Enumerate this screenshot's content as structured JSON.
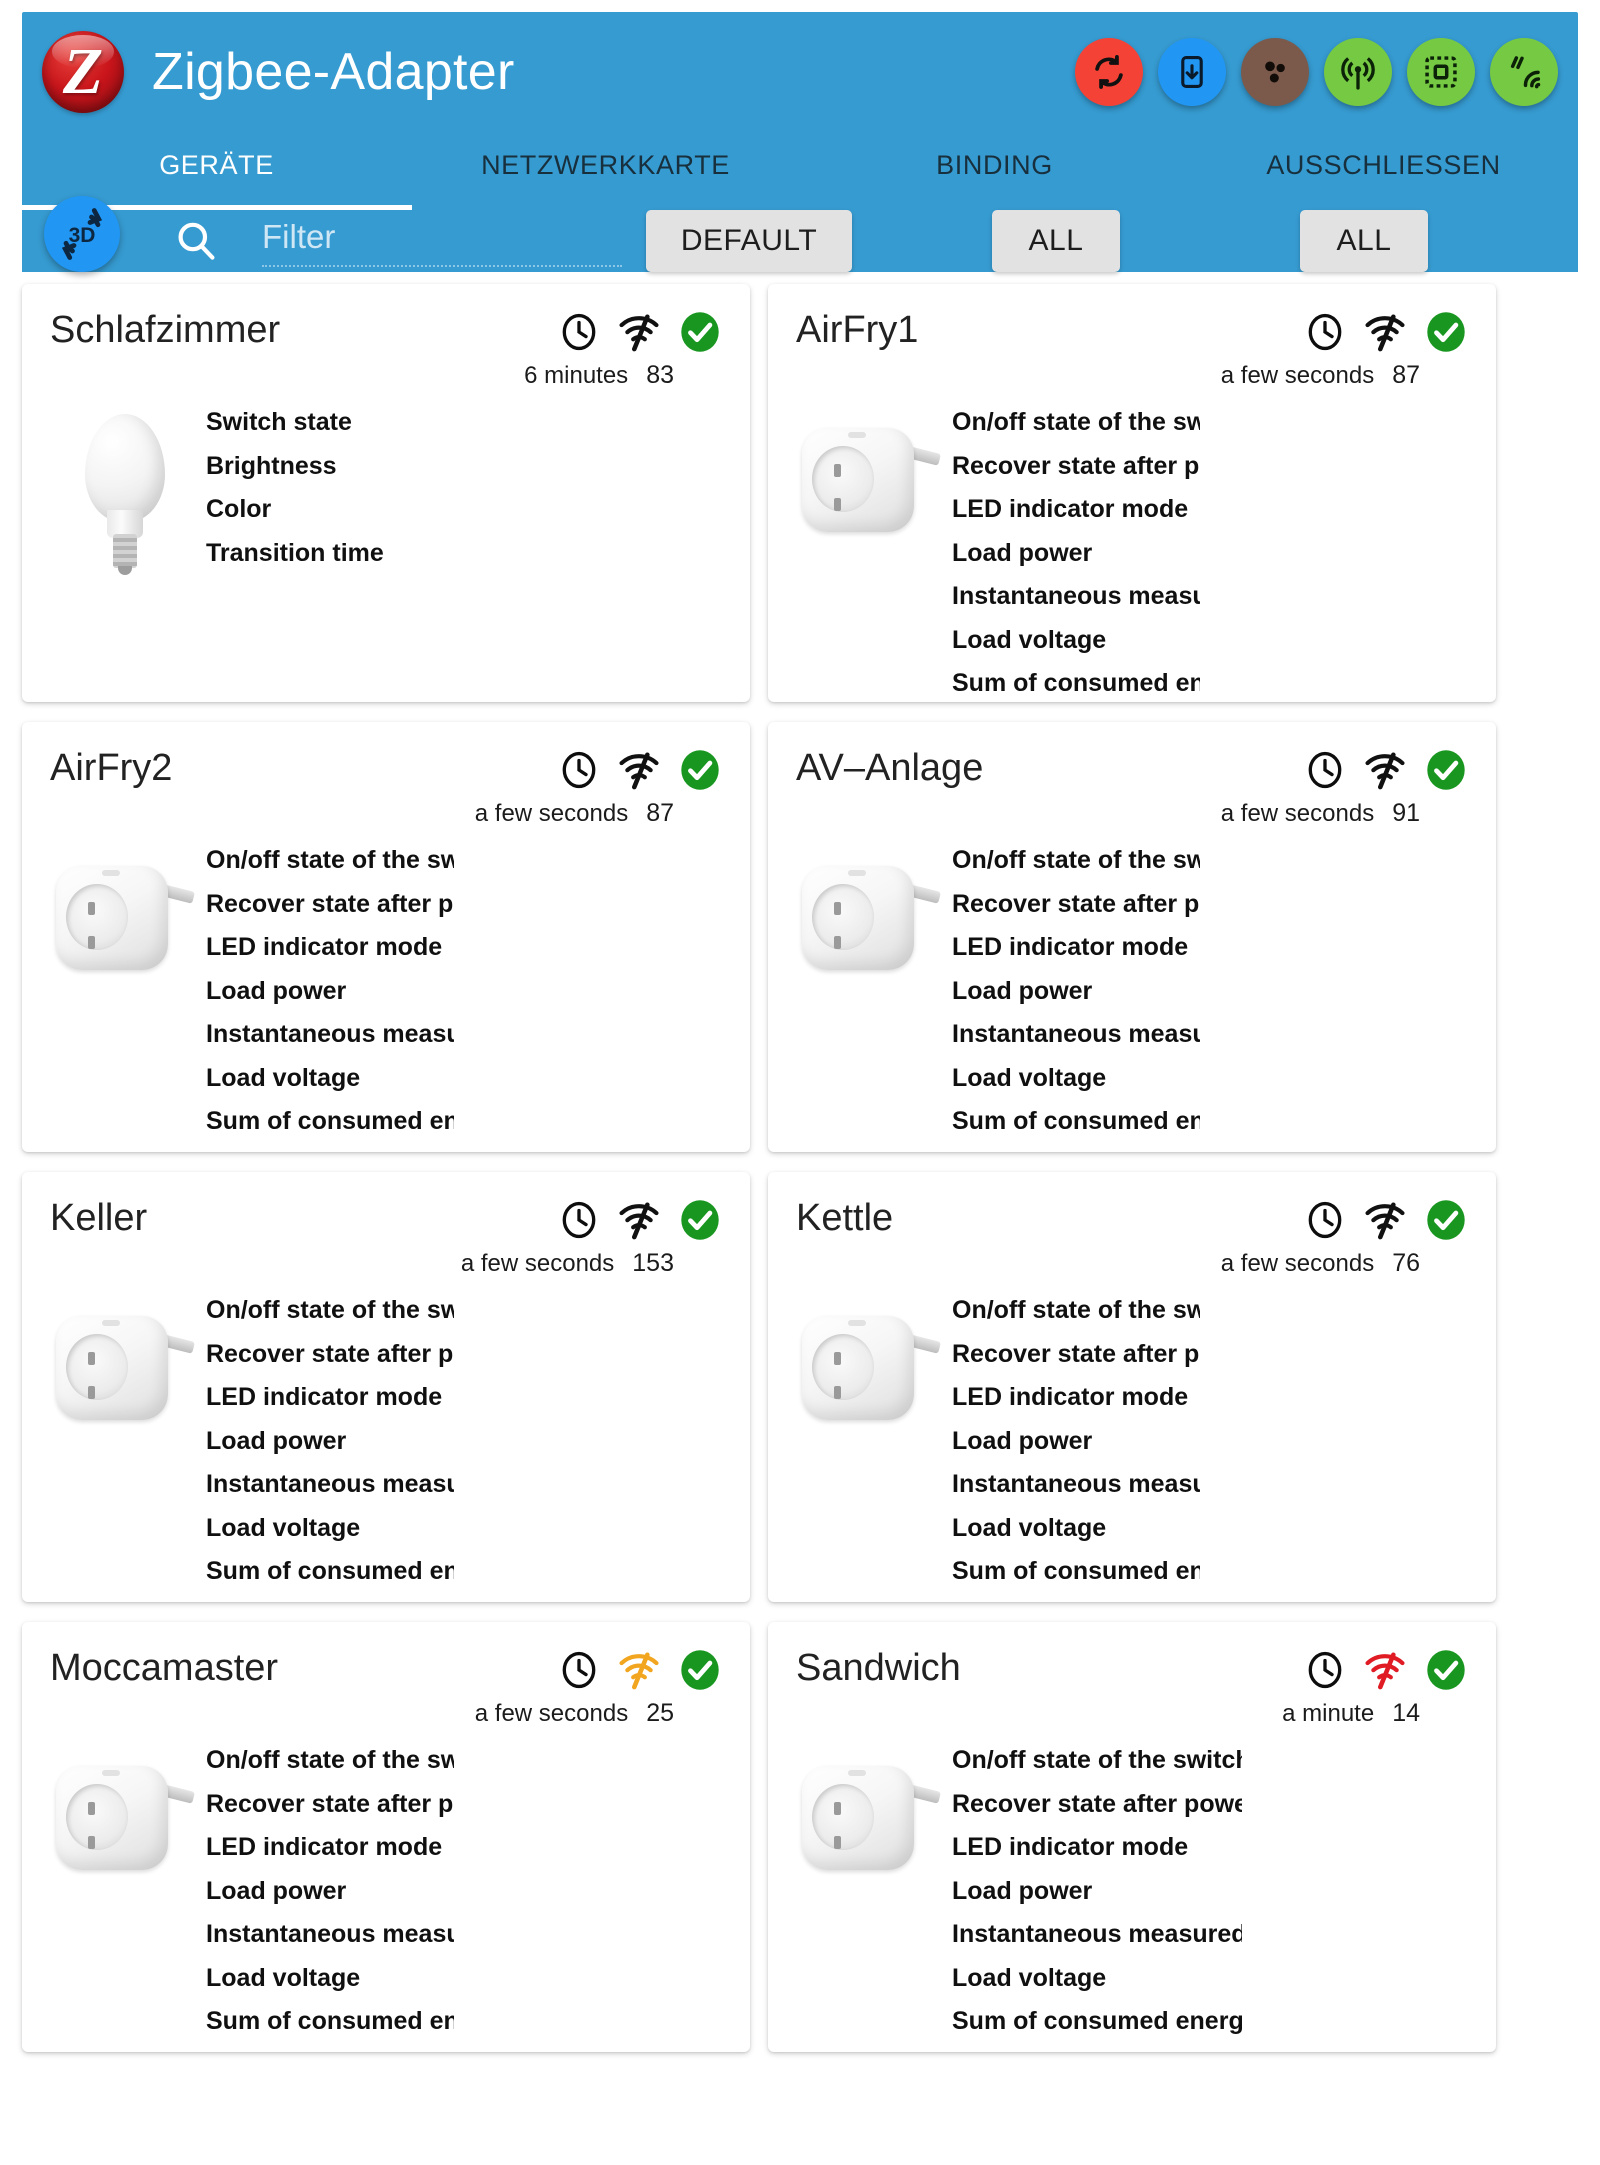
{
  "app": {
    "title": "Zigbee-Adapter",
    "logo_letter": "Z",
    "accent_blue": "#369bd1"
  },
  "actions": [
    {
      "name": "refresh-pairing",
      "icon": "refresh-icon",
      "color": "#f44336"
    },
    {
      "name": "download-to-device",
      "icon": "phone-download-icon",
      "color": "#2196f3"
    },
    {
      "name": "group-devices",
      "icon": "group-dots-icon",
      "color": "#7b5a4c"
    },
    {
      "name": "broadcast",
      "icon": "broadcast-icon",
      "color": "#76c942"
    },
    {
      "name": "coordinator-chip",
      "icon": "chip-icon",
      "color": "#76c942"
    },
    {
      "name": "touchlink",
      "icon": "touchlink-icon",
      "color": "#76c942"
    }
  ],
  "tabs": [
    {
      "label": "GERÄTE",
      "active": true
    },
    {
      "label": "NETZWERKKARTE",
      "active": false
    },
    {
      "label": "BINDING",
      "active": false
    },
    {
      "label": "AUSSCHLIESSEN",
      "active": false
    }
  ],
  "filterbar": {
    "view3d_label": "3D",
    "search_icon": "search-icon",
    "filter_value": "",
    "filter_placeholder": "Filter",
    "dropdown_default": "DEFAULT",
    "dropdown_all_1": "ALL",
    "dropdown_all_2": "ALL"
  },
  "status_colors": {
    "signal_good": "#111111",
    "signal_medium": "#f2a51e",
    "signal_weak": "#e01b24",
    "check_ok": "#18961f"
  },
  "devices": [
    {
      "name": "Schlafzimmer",
      "image": "lightbulb",
      "last_seen": "6 minutes",
      "link_quality": "83",
      "signal_level": "good",
      "connected": true,
      "clip": "lamp",
      "height": "short",
      "properties": [
        "Switch state",
        "Brightness",
        "Color",
        "Transition time"
      ]
    },
    {
      "name": "AirFry1",
      "image": "plug",
      "last_seen": "a few seconds",
      "link_quality": "87",
      "signal_level": "good",
      "connected": true,
      "clip": "narrow",
      "height": "short",
      "properties": [
        "On/off state of the switch",
        "Recover state after power outage",
        "LED indicator mode",
        "Load power",
        "Instantaneous measured electrical power",
        "Load voltage",
        "Sum of consumed energy"
      ]
    },
    {
      "name": "AirFry2",
      "image": "plug",
      "last_seen": "a few seconds",
      "link_quality": "87",
      "signal_level": "good",
      "connected": true,
      "clip": "narrow",
      "height": "tall",
      "properties": [
        "On/off state of the switch",
        "Recover state after power outage",
        "LED indicator mode",
        "Load power",
        "Instantaneous measured electrical power",
        "Load voltage",
        "Sum of consumed energy"
      ]
    },
    {
      "name": "AV–Anlage",
      "image": "plug",
      "last_seen": "a few seconds",
      "link_quality": "91",
      "signal_level": "good",
      "connected": true,
      "clip": "narrow",
      "height": "tall",
      "properties": [
        "On/off state of the switch",
        "Recover state after power outage",
        "LED indicator mode",
        "Load power",
        "Instantaneous measured electrical power",
        "Load voltage",
        "Sum of consumed energy"
      ]
    },
    {
      "name": "Keller",
      "image": "plug",
      "last_seen": "a few seconds",
      "link_quality": "153",
      "signal_level": "good",
      "connected": true,
      "clip": "narrow",
      "height": "tall",
      "properties": [
        "On/off state of the switch",
        "Recover state after power outage",
        "LED indicator mode",
        "Load power",
        "Instantaneous measured electrical power",
        "Load voltage",
        "Sum of consumed energy"
      ]
    },
    {
      "name": "Kettle",
      "image": "plug",
      "last_seen": "a few seconds",
      "link_quality": "76",
      "signal_level": "good",
      "connected": true,
      "clip": "narrow",
      "height": "tall",
      "properties": [
        "On/off state of the switch",
        "Recover state after power outage",
        "LED indicator mode",
        "Load power",
        "Instantaneous measured electrical power",
        "Load voltage",
        "Sum of consumed energy"
      ]
    },
    {
      "name": "Moccamaster",
      "image": "plug",
      "last_seen": "a few seconds",
      "link_quality": "25",
      "signal_level": "medium",
      "connected": true,
      "clip": "narrow",
      "height": "tall",
      "properties": [
        "On/off state of the switch",
        "Recover state after power outage",
        "LED indicator mode",
        "Load power",
        "Instantaneous measured electrical power",
        "Load voltage",
        "Sum of consumed energy"
      ]
    },
    {
      "name": "Sandwich",
      "image": "plug",
      "last_seen": "a minute",
      "link_quality": "14",
      "signal_level": "weak",
      "connected": true,
      "clip": "wide",
      "height": "tall",
      "properties": [
        "On/off state of the switch",
        "Recover state after power outage",
        "LED indicator mode",
        "Load power",
        "Instantaneous measured electrical power",
        "Load voltage",
        "Sum of consumed energy"
      ]
    }
  ]
}
